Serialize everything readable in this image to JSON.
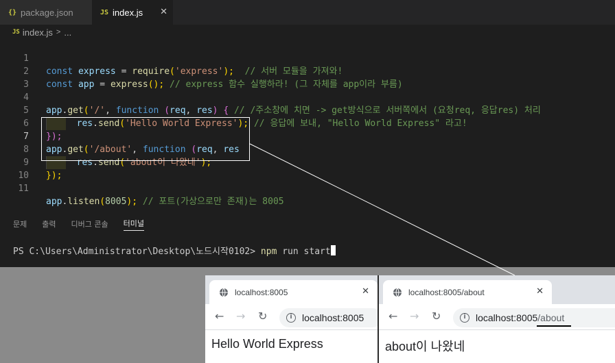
{
  "editor": {
    "tabs": [
      {
        "icon": "{}",
        "label": "package.json"
      },
      {
        "icon": "JS",
        "label": "index.js"
      }
    ],
    "close_glyph": "✕",
    "breadcrumb": {
      "icon": "JS",
      "file": "index.js",
      "sep": ">",
      "more": "..."
    },
    "line_numbers": [
      "1",
      "2",
      "3",
      "4",
      "5",
      "6",
      "7",
      "8",
      "9",
      "10",
      "11"
    ],
    "code": {
      "l1": {
        "kw": "const",
        "name": "express",
        "eq": " = ",
        "fn": "require",
        "open": "(",
        "str": "'express'",
        "close": ");",
        "cm": "  // 서버 모듈을 가져와!"
      },
      "l2": {
        "kw": "const",
        "name": "app",
        "eq": " = ",
        "fn": "express",
        "call": "();",
        "cm": " // express 함수 실행하라! (그 자체를 app이라 부름)"
      },
      "l4": {
        "obj": "app",
        "dot": ".",
        "fn": "get",
        "open": "(",
        "str": "'/'",
        "comma": ", ",
        "kw": "function",
        "params_open": " (",
        "p1": "req",
        "psep": ", ",
        "p2": "res",
        "params_close": ")",
        "brace": " {",
        "cm": " // /주소창에 치면 -> get방식으로 서버쪽에서 (요청req, 응답res) 처리"
      },
      "l5": {
        "obj": "res",
        "dot": ".",
        "fn": "send",
        "open": "(",
        "str": "'Hello World Express'",
        "close": ");",
        "cm": " // 응답에 보내, \"Hello World Express\" 라고!"
      },
      "l6": {
        "close": "});"
      },
      "l7": {
        "obj": "app",
        "dot": ".",
        "fn": "get",
        "open": "(",
        "str": "'/about'",
        "comma": ", ",
        "kw": "function",
        "params_open": " (",
        "p1": "req",
        "psep": ", ",
        "p2": "res"
      },
      "l8": {
        "obj": "res",
        "dot": ".",
        "fn": "send",
        "open": "(",
        "str": "'about이 나왔네'",
        "close": ");"
      },
      "l9": {
        "close": "});"
      },
      "l11": {
        "obj": "app",
        "dot": ".",
        "fn": "listen",
        "open": "(",
        "num": "8005",
        "close": ");",
        "cm": " // 포트(가상으로만 존재)는 8005"
      }
    },
    "panel_tabs": [
      "문제",
      "출력",
      "디버그 콘솔",
      "터미널"
    ],
    "terminal": {
      "prompt": "PS C:\\Users\\Administrator\\Desktop\\노드시작0102> ",
      "cmd": "npm",
      "args": " run start"
    }
  },
  "browsers": [
    {
      "tab_title": "localhost:8005",
      "url_host": "localhost:8005",
      "url_path": "",
      "content": "Hello World Express"
    },
    {
      "tab_title": "localhost:8005/about",
      "url_host": "localhost:8005",
      "url_path": "/about",
      "content": "about이 나왔네"
    }
  ],
  "browser_glyphs": {
    "back": "←",
    "forward": "→",
    "reload": "↻",
    "info": "i",
    "close": "✕"
  }
}
